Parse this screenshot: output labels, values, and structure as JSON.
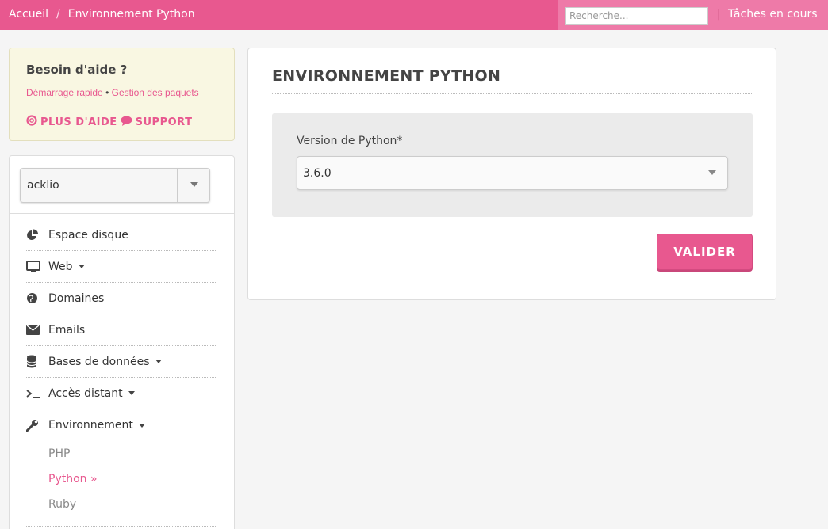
{
  "breadcrumb": {
    "home": "Accueil",
    "separator": "/",
    "current": "Environnement Python"
  },
  "topbar": {
    "search_placeholder": "Recherche...",
    "pipe": "|",
    "tasks": "Tâches en cours"
  },
  "help": {
    "title": "Besoin d'aide ?",
    "link_quickstart": "Démarrage rapide",
    "bullet": "•",
    "link_packages": "Gestion des paquets",
    "more_help": "PLUS D'AIDE",
    "support": "SUPPORT"
  },
  "account_select": {
    "value": "acklio"
  },
  "menu": {
    "disk": "Espace disque",
    "web": "Web",
    "domains": "Domaines",
    "emails": "Emails",
    "databases": "Bases de données",
    "remote": "Accès distant",
    "environment": "Environnement",
    "env_items": {
      "php": "PHP",
      "python": "Python »",
      "ruby": "Ruby"
    }
  },
  "main": {
    "title": "ENVIRONNEMENT PYTHON",
    "field_label": "Version de Python*",
    "selected_version": "3.6.0",
    "submit_label": "VALIDER"
  },
  "colors": {
    "accent": "#e8588f",
    "help_bg": "#f9f7e2"
  },
  "icons": [
    "pie-chart-icon",
    "monitor-icon",
    "globe-icon",
    "envelope-icon",
    "database-icon",
    "terminal-icon",
    "wrench-icon",
    "lifebuoy-icon",
    "chat-bubble-icon",
    "caret-down-icon"
  ]
}
